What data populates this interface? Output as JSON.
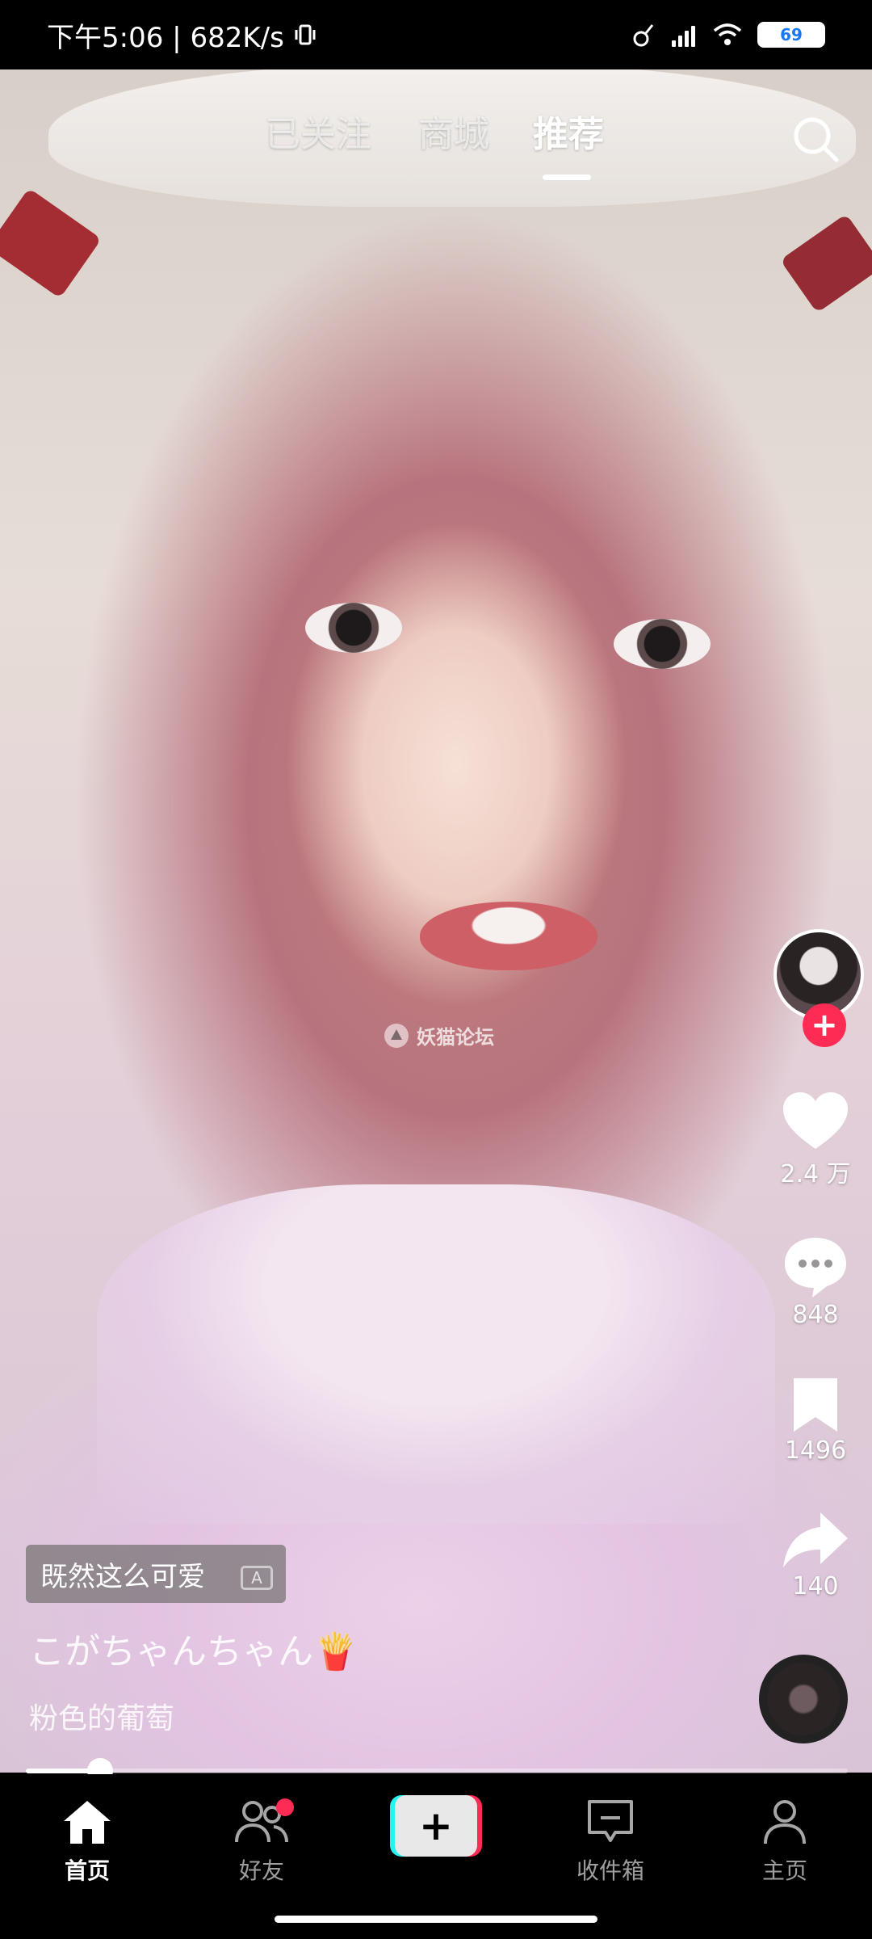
{
  "status_bar": {
    "time": "下午5:06",
    "net_speed": "682K/s",
    "battery": "69"
  },
  "top_tabs": [
    {
      "label": "已关注"
    },
    {
      "label": "商城"
    },
    {
      "label": "推荐",
      "active": true
    }
  ],
  "watermark": "妖猫论坛",
  "right_rail": {
    "like_count": "2.4 万",
    "comment_count": "848",
    "favorite_count": "1496",
    "share_count": "140",
    "follow_symbol": "+"
  },
  "caption": {
    "tag_text": "既然这么可爱",
    "tag_icon_text": "A",
    "username": "こがちゃんちゃん🍟",
    "description": "粉色的葡萄"
  },
  "progress": {
    "fraction": 0.09
  },
  "bottom_nav": {
    "items": [
      {
        "label": "首页",
        "icon": "home-icon",
        "active": true
      },
      {
        "label": "好友",
        "icon": "friends-icon",
        "badge": true
      },
      {
        "label": "+",
        "icon": "create-plus-icon"
      },
      {
        "label": "收件箱",
        "icon": "inbox-icon"
      },
      {
        "label": "主页",
        "icon": "profile-icon"
      }
    ]
  },
  "colors": {
    "accent_red": "#fe2c55",
    "accent_cyan": "#25f4ee",
    "battery_blue": "#1877f2"
  }
}
